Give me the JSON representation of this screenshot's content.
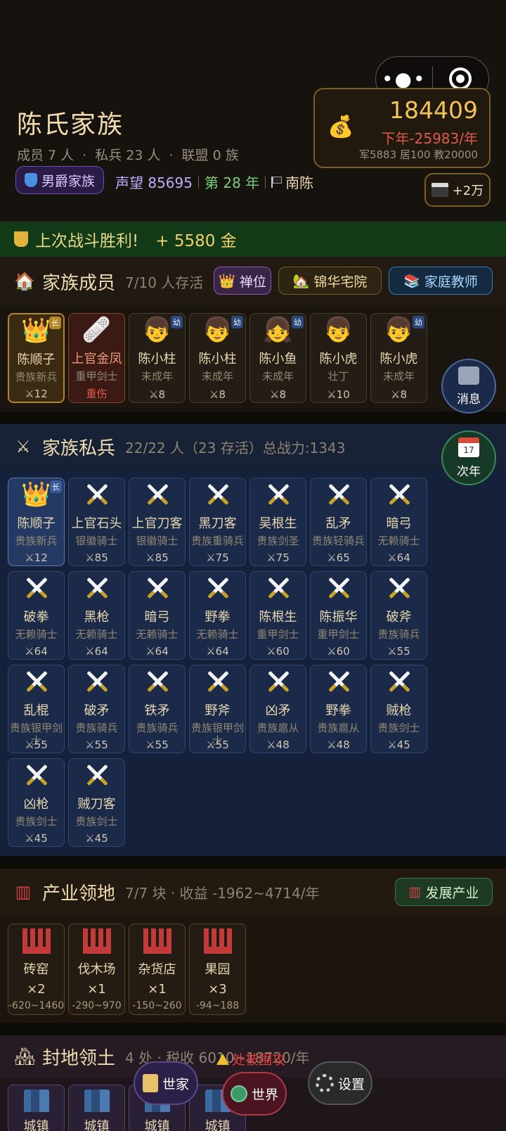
{
  "header": {
    "family_name": "陈氏家族",
    "members_label": "成员 7 人",
    "soldiers_label": "私兵 23 人",
    "alliance_label": "联盟 0 族",
    "separator": "·",
    "rank_badge": "男爵家族",
    "prestige_label": "声望 85695",
    "year_label": "第 28 年",
    "region_label": "南陈",
    "capsule_more": "•●•",
    "gold": {
      "amount": "184409",
      "income": "下年-25983/年",
      "detail": "军5883 居100 教20000"
    },
    "ad_reward": "+2万"
  },
  "battle_banner": {
    "text": "上次战斗胜利!",
    "reward": "+ 5580 金"
  },
  "members_section": {
    "title": "家族成员",
    "subtitle": "7/10 人存活",
    "abdicate_button": "禅位",
    "residence_button": "锦华宅院 ",
    "tutor_button": "家庭教师 ",
    "members": [
      {
        "name": "陈顺子",
        "class": "贵族新兵",
        "power": "⚔12",
        "tag": "长",
        "icon": "👑",
        "type": "leader"
      },
      {
        "name": "上官金凤",
        "class": "重甲剑士",
        "power": "重伤",
        "tag": "",
        "icon": "🩹",
        "type": "hurt"
      },
      {
        "name": "陈小柱",
        "class": "未成年",
        "power": "⚔8",
        "tag": "幼",
        "icon": "👦",
        "type": "normal"
      },
      {
        "name": "陈小柱",
        "class": "未成年",
        "power": "⚔8",
        "tag": "幼",
        "icon": "👦",
        "type": "normal"
      },
      {
        "name": "陈小鱼",
        "class": "未成年",
        "power": "⚔8",
        "tag": "幼",
        "icon": "👧",
        "type": "normal"
      },
      {
        "name": "陈小虎",
        "class": "壮丁",
        "power": "⚔10",
        "tag": "",
        "icon": "👦",
        "type": "normal"
      },
      {
        "name": "陈小虎",
        "class": "未成年",
        "power": "⚔8",
        "tag": "幼",
        "icon": "👦",
        "type": "normal"
      }
    ]
  },
  "soldiers_section": {
    "title": "家族私兵",
    "subtitle": "22/22 人（23 存活）总战力:1343",
    "soldiers": [
      {
        "name": "陈顺子",
        "class": "贵族新兵",
        "power": "⚔12",
        "tag": "长",
        "leader": true
      },
      {
        "name": "上官石头",
        "class": "银徽骑士",
        "power": "⚔85"
      },
      {
        "name": "上官刀客",
        "class": "银徽骑士",
        "power": "⚔85"
      },
      {
        "name": "黑刀客",
        "class": "贵族重骑兵",
        "power": "⚔75"
      },
      {
        "name": "吴根生",
        "class": "贵族剑圣",
        "power": "⚔75"
      },
      {
        "name": "乱矛",
        "class": "贵族轻骑兵",
        "power": "⚔65"
      },
      {
        "name": "暗弓",
        "class": "无赖骑士",
        "power": "⚔64"
      },
      {
        "name": "破拳",
        "class": "无赖骑士",
        "power": "⚔64"
      },
      {
        "name": "黑枪",
        "class": "无赖骑士",
        "power": "⚔64"
      },
      {
        "name": "暗弓",
        "class": "无赖骑士",
        "power": "⚔64"
      },
      {
        "name": "野拳",
        "class": "无赖骑士",
        "power": "⚔64"
      },
      {
        "name": "陈根生",
        "class": "重甲剑士",
        "power": "⚔60"
      },
      {
        "name": "陈振华",
        "class": "重甲剑士",
        "power": "⚔60"
      },
      {
        "name": "破斧",
        "class": "贵族骑兵",
        "power": "⚔55"
      },
      {
        "name": "乱棍",
        "class": "贵族银甲剑士",
        "power": "⚔55"
      },
      {
        "name": "破矛",
        "class": "贵族骑兵",
        "power": "⚔55"
      },
      {
        "name": "铁矛",
        "class": "贵族骑兵",
        "power": "⚔55"
      },
      {
        "name": "野斧",
        "class": "贵族银甲剑士",
        "power": "⚔55"
      },
      {
        "name": "凶矛",
        "class": "贵族扈从",
        "power": "⚔48"
      },
      {
        "name": "野拳",
        "class": "贵族扈从",
        "power": "⚔48"
      },
      {
        "name": "贼枪",
        "class": "贵族剑士",
        "power": "⚔45"
      },
      {
        "name": "凶枪",
        "class": "贵族剑士",
        "power": "⚔45"
      },
      {
        "name": "贼刀客",
        "class": "贵族剑士",
        "power": "⚔45"
      }
    ]
  },
  "industry_section": {
    "title": "产业领地",
    "subtitle": "7/7 块  ·  收益 -1962~4714/年",
    "develop_button": "发展产业",
    "items": [
      {
        "name": "砖窑",
        "count": "×2",
        "range": "-620~1460"
      },
      {
        "name": "伐木场",
        "count": "×1",
        "range": "-290~970"
      },
      {
        "name": "杂货店",
        "count": "×1",
        "range": "-150~260"
      },
      {
        "name": "果园",
        "count": "×3",
        "range": "-94~188"
      }
    ]
  },
  "fief_section": {
    "title": "封地领土",
    "subtitle": "4 处  ·  税收 6010~18720/年",
    "warning": "处被围攻",
    "towns": [
      {
        "name": "城镇"
      },
      {
        "name": "城镇"
      },
      {
        "name": "城镇"
      },
      {
        "name": "城镇"
      }
    ]
  },
  "floating": {
    "messages": "消息",
    "next_year": "次年",
    "calendar_text": "17"
  },
  "nav": {
    "family": "世家",
    "world": "世界",
    "settings": "设置"
  },
  "colors": {
    "gold": "#f2c35a",
    "deficit": "#e05a4a",
    "soldier_bg": "#15203a",
    "battle_bg": "#123a16"
  }
}
